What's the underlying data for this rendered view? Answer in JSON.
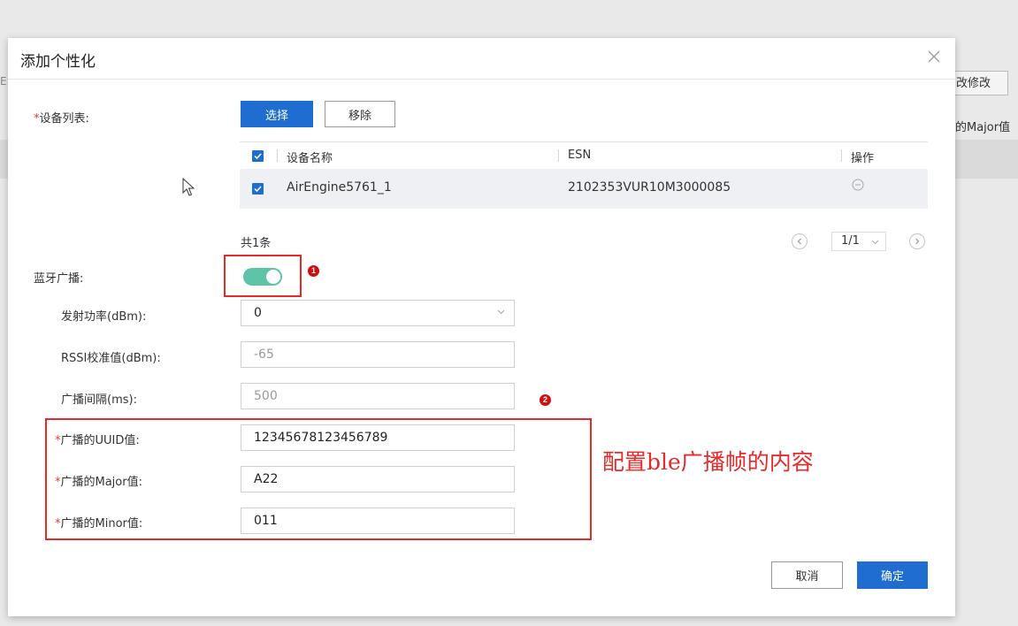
{
  "background": {
    "left_fragment": "E",
    "right_button": "改修改",
    "right_text": "的Major值"
  },
  "dialog": {
    "title": "添加个性化",
    "close_icon": "close-icon"
  },
  "device_list": {
    "required_mark": "*",
    "label": "设备列表:",
    "select_button": "选择",
    "remove_button": "移除",
    "columns": [
      "设备名称",
      "ESN",
      "操作"
    ],
    "rows": [
      {
        "name": "AirEngine5761_1",
        "esn": "2102353VUR10M3000085",
        "action_icon": "minus-circle-icon",
        "checked": true
      }
    ],
    "total": "共1条",
    "page_indicator": "1/1"
  },
  "bluetooth": {
    "label": "蓝牙广播:",
    "enabled": true,
    "badge1": "1",
    "badge2": "2"
  },
  "fields": {
    "tx_power": {
      "label": "发射功率(dBm):",
      "value": "0"
    },
    "rssi": {
      "label": "RSSI校准值(dBm):",
      "value": "-65"
    },
    "interval": {
      "label": "广播间隔(ms):",
      "value": "500"
    },
    "uuid": {
      "required_mark": "*",
      "label": "广播的UUID值:",
      "value": "12345678123456789"
    },
    "major": {
      "required_mark": "*",
      "label": "广播的Major值:",
      "value": "A22"
    },
    "minor": {
      "required_mark": "*",
      "label": "广播的Minor值:",
      "value": "011"
    }
  },
  "annotation": "配置ble广播帧的内容",
  "footer": {
    "cancel": "取消",
    "confirm": "确定"
  },
  "colors": {
    "primary": "#1f6dd1",
    "toggle_on": "#5ec4a9",
    "highlight": "#e52a2a"
  }
}
